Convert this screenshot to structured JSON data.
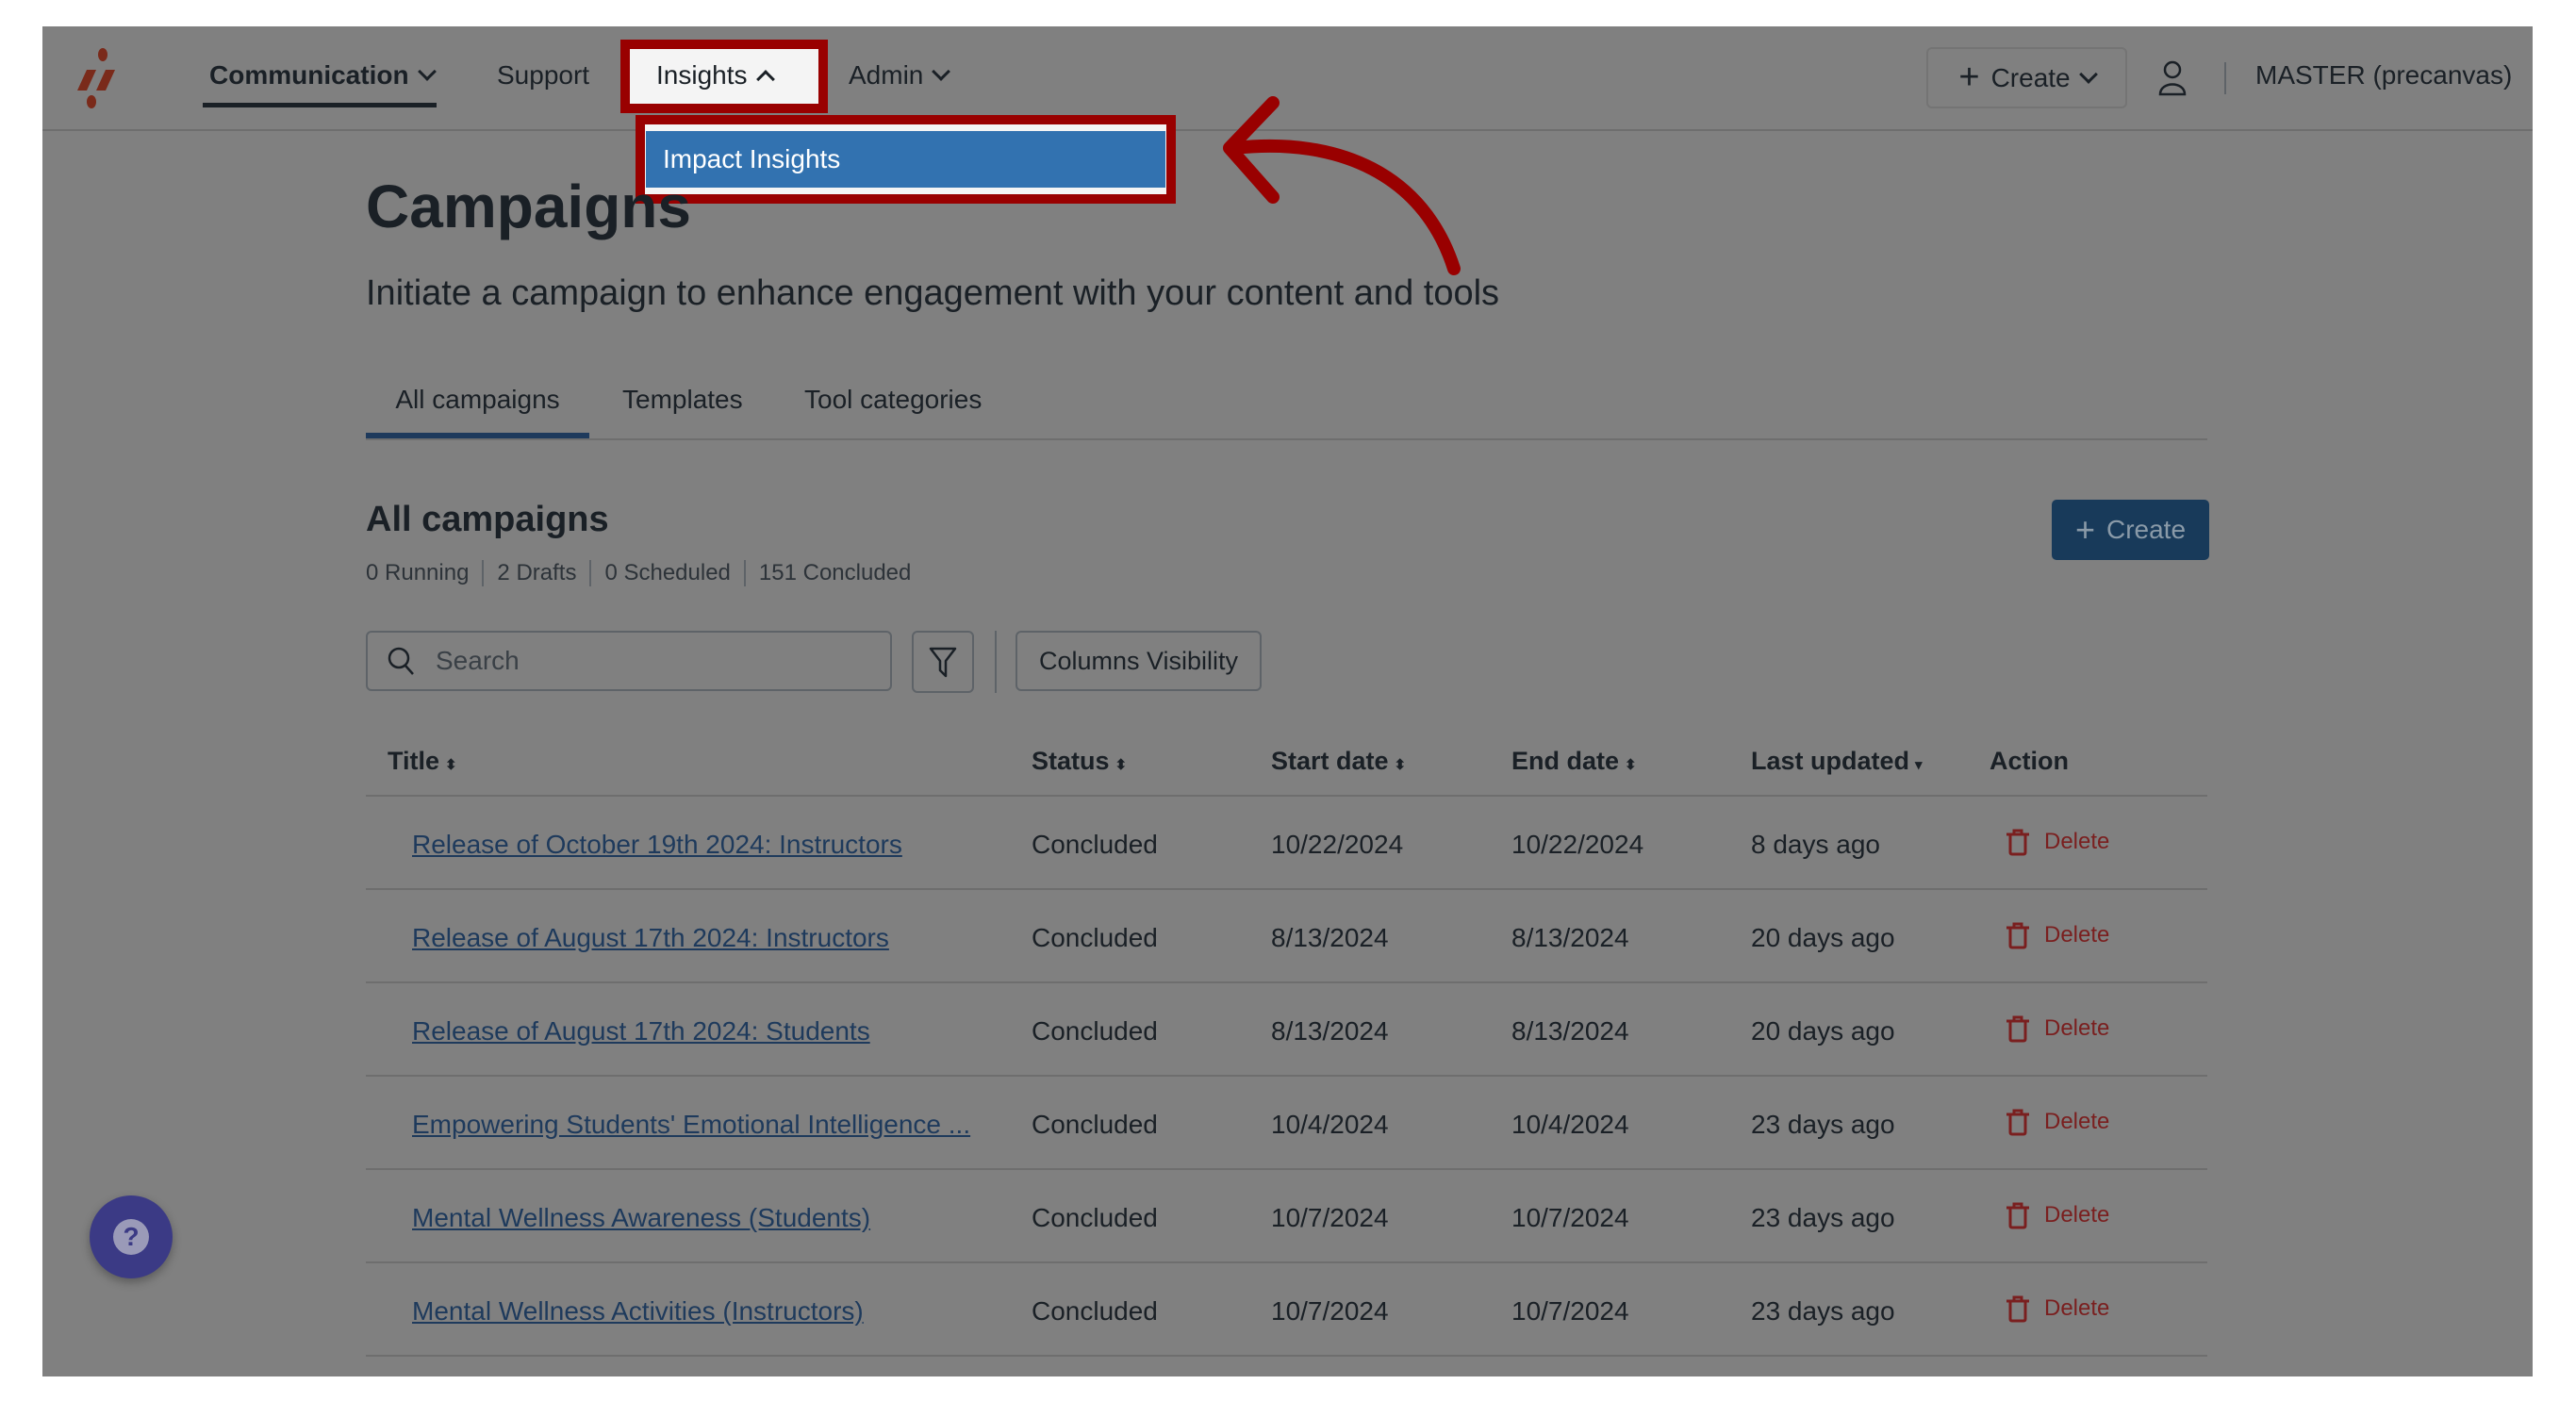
{
  "nav": {
    "items": [
      {
        "label": "Communication",
        "active": true
      },
      {
        "label": "Support"
      },
      {
        "label": "Insights",
        "open": true
      },
      {
        "label": "Admin"
      }
    ],
    "dropdown": {
      "items": [
        {
          "label": "Impact Insights",
          "highlighted": true
        }
      ]
    },
    "create_label": "Create",
    "account_label": "MASTER (precanvas)"
  },
  "page": {
    "title": "Campaigns",
    "subtitle": "Initiate a campaign to enhance engagement with your content and tools",
    "tabs": [
      {
        "label": "All campaigns",
        "active": true
      },
      {
        "label": "Templates"
      },
      {
        "label": "Tool categories"
      }
    ],
    "section_title": "All campaigns",
    "counts": [
      "0 Running",
      "2 Drafts",
      "0 Scheduled",
      "151 Concluded"
    ],
    "create_button": "Create",
    "search_placeholder": "Search",
    "columns_visibility": "Columns Visibility"
  },
  "table": {
    "headers": [
      "Title",
      "Status",
      "Start date",
      "End date",
      "Last updated",
      "Action"
    ],
    "rows": [
      {
        "title": "Release of October 19th 2024: Instructors",
        "status": "Concluded",
        "start": "10/22/2024",
        "end": "10/22/2024",
        "updated": "8 days ago",
        "action": "Delete"
      },
      {
        "title": "Release of August 17th 2024: Instructors",
        "status": "Concluded",
        "start": "8/13/2024",
        "end": "8/13/2024",
        "updated": "20 days ago",
        "action": "Delete"
      },
      {
        "title": "Release of August 17th 2024: Students",
        "status": "Concluded",
        "start": "8/13/2024",
        "end": "8/13/2024",
        "updated": "20 days ago",
        "action": "Delete"
      },
      {
        "title": "Empowering Students' Emotional Intelligence ...",
        "status": "Concluded",
        "start": "10/4/2024",
        "end": "10/4/2024",
        "updated": "23 days ago",
        "action": "Delete"
      },
      {
        "title": "Mental Wellness Awareness (Students)",
        "status": "Concluded",
        "start": "10/7/2024",
        "end": "10/7/2024",
        "updated": "23 days ago",
        "action": "Delete"
      },
      {
        "title": "Mental Wellness Activities (Instructors)",
        "status": "Concluded",
        "start": "10/7/2024",
        "end": "10/7/2024",
        "updated": "23 days ago",
        "action": "Delete"
      }
    ]
  },
  "colors": {
    "highlight": "#990000",
    "menu_item": "#3272b0",
    "primary": "#183a5a",
    "danger": "#7a1f1f",
    "overlay": "#808080"
  }
}
